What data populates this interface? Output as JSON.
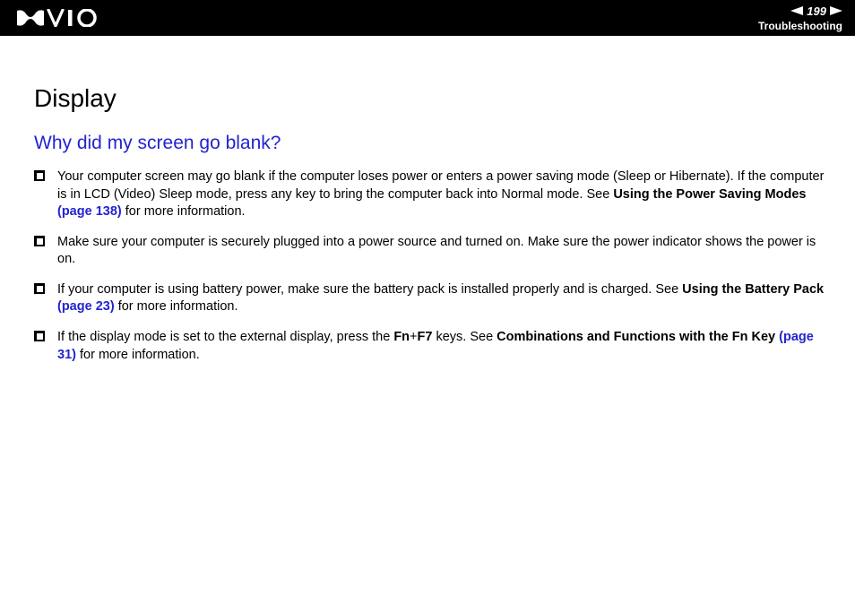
{
  "header": {
    "page_number": "199",
    "section": "Troubleshooting"
  },
  "content": {
    "title": "Display",
    "question": "Why did my screen go blank?",
    "items": [
      {
        "pre": "Your computer screen may go blank if the computer loses power or enters a power saving mode (Sleep or Hibernate). If the computer is in LCD (Video) Sleep mode, press any key to bring the computer back into Normal mode. See ",
        "bold1": "Using the Power Saving Modes ",
        "link": "(page 138)",
        "post": " for more information."
      },
      {
        "pre": "Make sure your computer is securely plugged into a power source and turned on. Make sure the power indicator shows the power is on.",
        "bold1": "",
        "link": "",
        "post": ""
      },
      {
        "pre": "If your computer is using battery power, make sure the battery pack is installed properly and is charged. See ",
        "bold1": "Using the Battery Pack ",
        "link": "(page 23)",
        "post": " for more information."
      },
      {
        "pre": "If the display mode is set to the external display, press the ",
        "bold1": "Fn",
        "mid1": "+",
        "bold2": "F7",
        "mid2": " keys. See ",
        "bold3": "Combinations and Functions with the Fn Key ",
        "link": "(page 31)",
        "post": " for more information."
      }
    ]
  }
}
